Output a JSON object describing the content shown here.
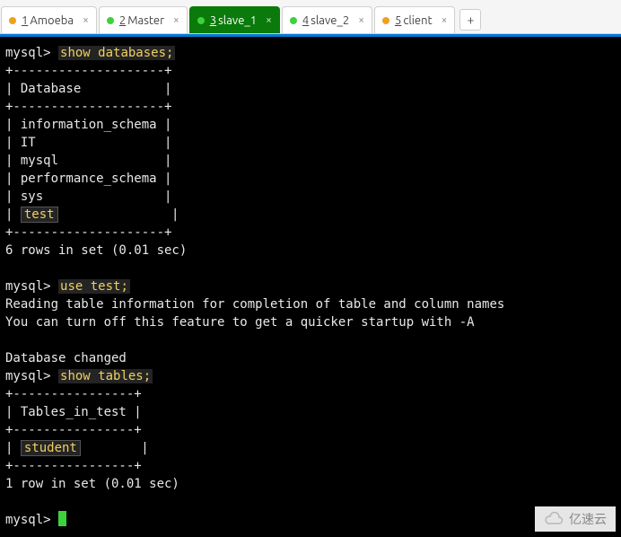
{
  "tabs": [
    {
      "index": "1",
      "label": "Amoeba",
      "dot": "orange",
      "active": false
    },
    {
      "index": "2",
      "label": "Master",
      "dot": "green",
      "active": false
    },
    {
      "index": "3",
      "label": "slave_1",
      "dot": "green",
      "active": true
    },
    {
      "index": "4",
      "label": "slave_2",
      "dot": "green",
      "active": false
    },
    {
      "index": "5",
      "label": "client",
      "dot": "orange",
      "active": false
    }
  ],
  "add_tab_label": "+",
  "terminal": {
    "prompt": "mysql>",
    "commands": {
      "show_db": "show databases;",
      "use_test": "use test;",
      "show_tables": "show tables;"
    },
    "db_header": "Database",
    "db_border_top": "+--------------------+",
    "db_border_bottom": "+--------------------+",
    "databases": [
      "information_schema",
      "IT",
      "mysql",
      "performance_schema",
      "sys"
    ],
    "db_highlighted": "test",
    "db_footer": "6 rows in set (0.01 sec)",
    "use_msg1": "Reading table information for completion of table and column names",
    "use_msg2": "You can turn off this feature to get a quicker startup with -A",
    "use_changed": "Database changed",
    "tables_header": "Tables_in_test",
    "tables_border": "+----------------+",
    "tables_highlighted": "student",
    "tables_footer": "1 row in set (0.01 sec)"
  },
  "watermark": "亿速云"
}
